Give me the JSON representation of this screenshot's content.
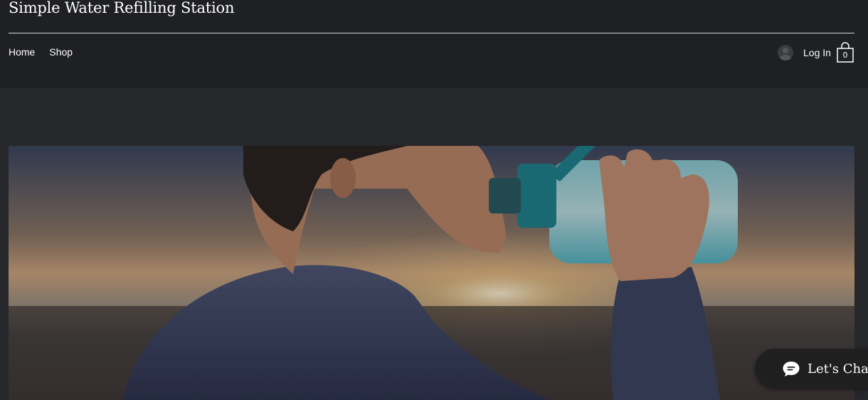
{
  "site": {
    "title": "Simple Water Refilling Station"
  },
  "nav": {
    "items": [
      {
        "label": "Home"
      },
      {
        "label": "Shop"
      }
    ]
  },
  "account": {
    "login_label": "Log In"
  },
  "cart": {
    "count": "0"
  },
  "chat": {
    "label": "Let's Chat!"
  },
  "hero": {
    "image": "person-drinking-from-water-bottle-at-sunset-beach"
  },
  "colors": {
    "header_bg": "#1f2024",
    "page_bg": "#26272b",
    "text": "#ffffff",
    "chat_bg": "#1f1f1f"
  }
}
